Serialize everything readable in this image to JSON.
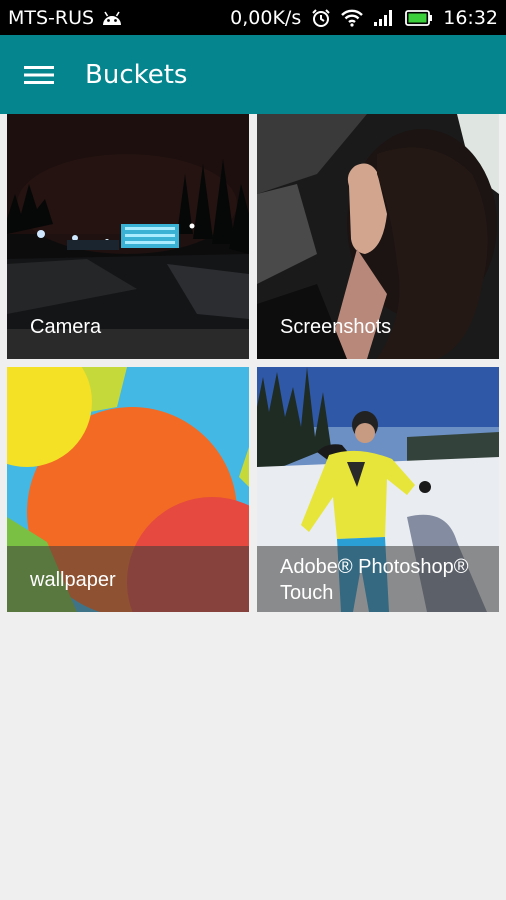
{
  "status_bar": {
    "carrier": "MTS-RUS",
    "net_speed": "0,00K/s",
    "time": "16:32",
    "icons": [
      "android-icon",
      "alarm-icon",
      "wifi-icon",
      "signal-icon",
      "battery-icon"
    ],
    "battery_color": "#3ccf3c"
  },
  "app_bar": {
    "title": "Buckets",
    "color": "#05868f",
    "menu_icon": "hamburger-menu-icon"
  },
  "buckets": [
    {
      "name": "Camera"
    },
    {
      "name": "Screenshots"
    },
    {
      "name": "wallpaper"
    },
    {
      "name": "Adobe® Photoshop® Touch"
    }
  ]
}
